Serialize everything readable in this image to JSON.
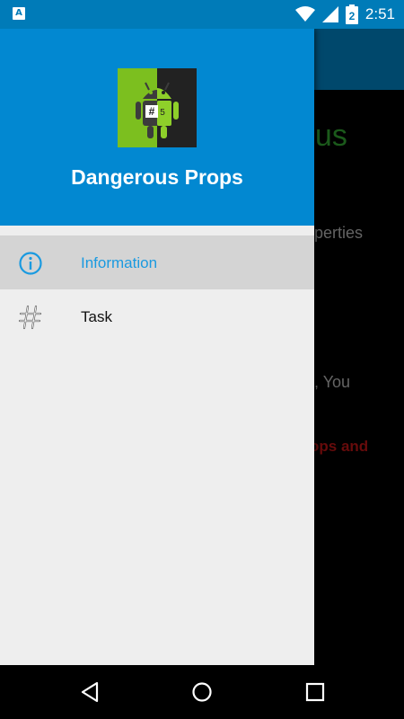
{
  "status_bar": {
    "notification_icon": "A",
    "battery_level": "2",
    "time": "2:51"
  },
  "background_app": {
    "title_fragment": "ous",
    "line1_fragment": "operties",
    "line2_fragment": "e, You",
    "line3_fragment": "ops and"
  },
  "drawer": {
    "app_name": "Dangerous Props",
    "logo_badge": "#5",
    "items": [
      {
        "label": "Information",
        "icon": "info-icon",
        "active": true
      },
      {
        "label": "Task",
        "icon": "hash-icon",
        "active": false
      }
    ]
  },
  "colors": {
    "status_bar": "#007bb8",
    "drawer_header": "#0288d1",
    "active_label": "#1a9ae0",
    "active_item_bg": "#d4d4d4",
    "drawer_bg": "#eeeeee"
  }
}
